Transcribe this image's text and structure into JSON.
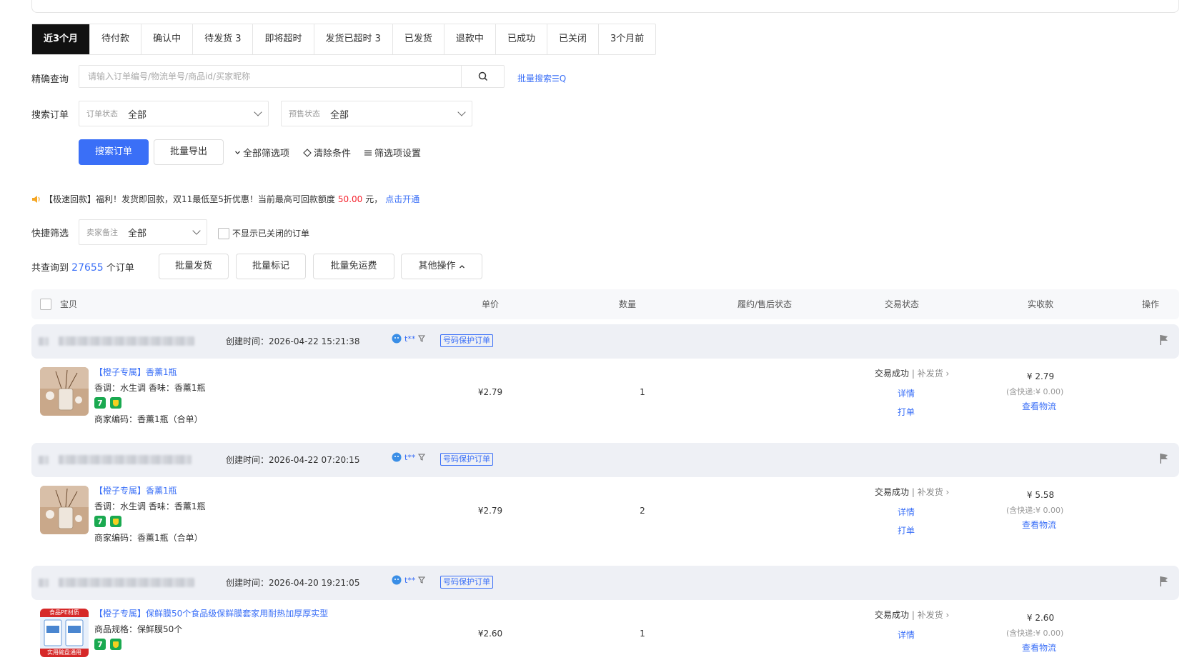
{
  "tabs": [
    {
      "label": "近3个月",
      "active": true
    },
    {
      "label": "待付款"
    },
    {
      "label": "确认中"
    },
    {
      "label": "待发货 3"
    },
    {
      "label": "即将超时"
    },
    {
      "label": "发货已超时 3"
    },
    {
      "label": "已发货"
    },
    {
      "label": "退款中"
    },
    {
      "label": "已成功"
    },
    {
      "label": "已关闭"
    },
    {
      "label": "3个月前"
    }
  ],
  "precise_search": {
    "label": "精确查询",
    "placeholder": "请输入订单编号/物流单号/商品id/买家昵称",
    "batch_search_link": "批量搜索☰Q"
  },
  "search_orders": {
    "label": "搜索订单",
    "order_status_label": "订单状态",
    "order_status_value": "全部",
    "presale_status_label": "预售状态",
    "presale_status_value": "全部"
  },
  "actions": {
    "search_button": "搜索订单",
    "export_button": "批量导出",
    "all_filters": "全部筛选项",
    "clear_conditions": "清除条件",
    "filter_settings": "筛选项设置"
  },
  "notice": {
    "text": "【极速回款】福利！发货即回款，双11最低至5折优惠！当前最高可回款额度",
    "amount": "50.00",
    "unit": "元，",
    "link": "点击开通"
  },
  "quick_filter": {
    "label": "快捷筛选",
    "remark_label": "卖家备注",
    "remark_value": "全部",
    "hide_closed_label": "不显示已关闭的订单"
  },
  "summary": {
    "prefix": "共查询到",
    "count": "27655",
    "suffix": "个订单"
  },
  "bulk_actions": {
    "batch_ship": "批量发货",
    "batch_mark": "批量标记",
    "batch_free_shipping": "批量免运费",
    "other_ops": "其他操作"
  },
  "table_headers": {
    "item": "宝贝",
    "unit_price": "单价",
    "quantity": "数量",
    "fulfillment": "履约/售后状态",
    "trade_status": "交易状态",
    "amount_received": "实收款",
    "operation": "操作"
  },
  "colors": {
    "accent": "#3a6ff7",
    "active_tab": "#111111",
    "order_header_bg": "#eef0f5",
    "amount_red": "#f5222d"
  },
  "orders": [
    {
      "created": "创建时间：2026-04-22 15:21:38",
      "buyer": "t**",
      "protect_tag": "号码保护订单",
      "title": "【橙子专属】香薰1瓶",
      "spec": "香调：水生调   香味：香薰1瓶",
      "code": "商家编码：香薰1瓶（合单）",
      "price": "¥2.79",
      "qty": "1",
      "status": "交易成功",
      "reship": "补发货",
      "detail": "详情",
      "print": "打单",
      "amount": "¥ 2.79",
      "shipping": "(含快递:¥ 0.00)",
      "logistics": "查看物流"
    },
    {
      "created": "创建时间：2026-04-22 07:20:15",
      "buyer": "t**",
      "protect_tag": "号码保护订单",
      "title": "【橙子专属】香薰1瓶",
      "spec": "香调：水生调   香味：香薰1瓶",
      "code": "商家编码：香薰1瓶（合单）",
      "price": "¥2.79",
      "qty": "2",
      "status": "交易成功",
      "reship": "补发货",
      "detail": "详情",
      "print": "打单",
      "amount": "¥ 5.58",
      "shipping": "(含快递:¥ 0.00)",
      "logistics": "查看物流"
    },
    {
      "created": "创建时间：2026-04-20 19:21:05",
      "buyer": "t**",
      "protect_tag": "号码保护订单",
      "title": "【橙子专属】保鲜膜50个食品级保鲜膜套家用耐热加厚厚实型",
      "spec": "商品规格：保鲜膜50个",
      "thumb_text_top": "食品PE材质",
      "thumb_text_bottom": "实用碗盘通用",
      "price": "¥2.60",
      "qty": "1",
      "status": "交易成功",
      "reship": "补发货",
      "detail": "详情",
      "amount": "¥ 2.60",
      "shipping": "(含快递:¥ 0.00)",
      "logistics": "查看物流"
    }
  ]
}
